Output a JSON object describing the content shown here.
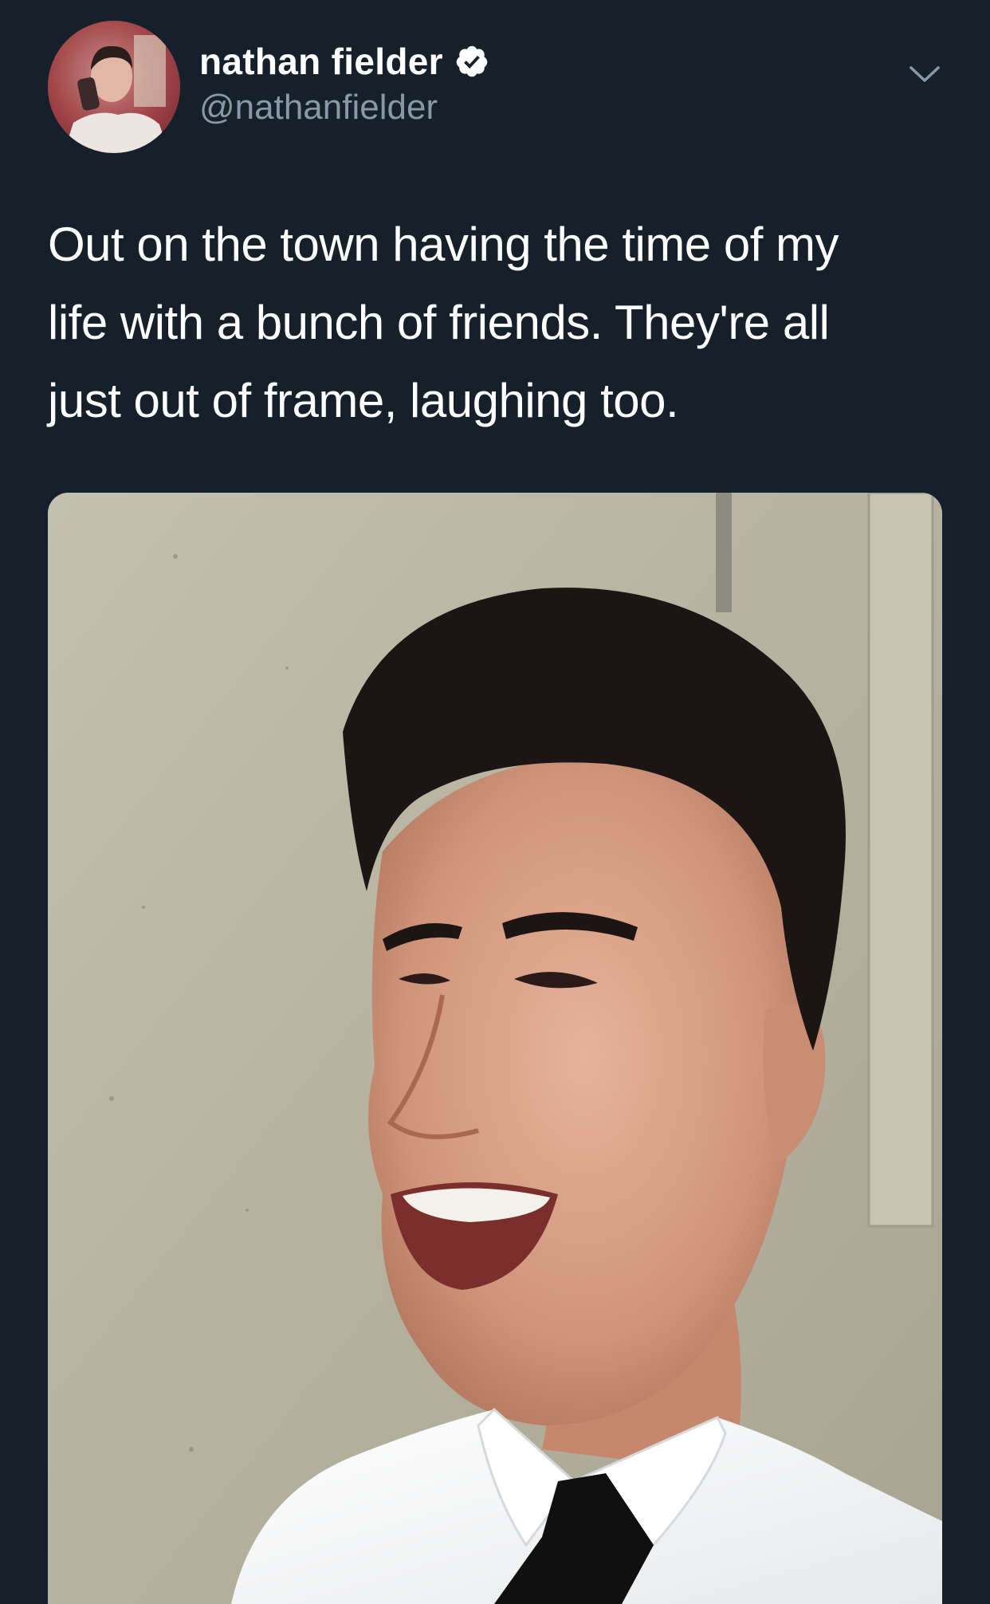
{
  "tweet": {
    "author": {
      "display_name": "nathan fielder",
      "handle": "@nathanfielder",
      "verified": true,
      "avatar_icon": "profile-photo"
    },
    "text_lines": [
      "Out on the town having the time of my",
      "life with a bunch of friends. They're all",
      "just out of frame, laughing too."
    ],
    "menu_icon": "chevron-down-icon",
    "media": {
      "type": "photo",
      "alt": ""
    },
    "colors": {
      "background": "#15202b",
      "text": "#ffffff",
      "secondary_text": "#8899a6",
      "verified_badge": "#ffffff"
    }
  }
}
